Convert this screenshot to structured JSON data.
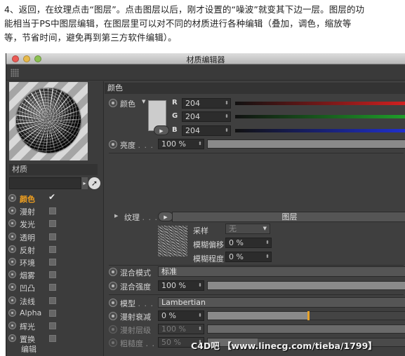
{
  "article": {
    "lines": [
      "4、返回，在纹理点击“图层”。点击图层以后，刚才设置的“噪波”就变其下边一层。图层的功",
      "能相当于PS中图层编辑，在图层里可以对不同的材质进行各种编辑（叠加，调色，缩放等",
      "等，节省时间，避免再到第三方软件编辑）。"
    ]
  },
  "window": {
    "title": "材质编辑器"
  },
  "left": {
    "material_label": "材质",
    "channels": [
      {
        "label": "颜色",
        "checked": true,
        "active": true
      },
      {
        "label": "漫射",
        "checked": false
      },
      {
        "label": "发光",
        "checked": false
      },
      {
        "label": "透明",
        "checked": false
      },
      {
        "label": "反射",
        "checked": false
      },
      {
        "label": "环境",
        "checked": false
      },
      {
        "label": "烟雾",
        "checked": false
      },
      {
        "label": "凹凸",
        "checked": false
      },
      {
        "label": "法线",
        "checked": false
      },
      {
        "label": "Alpha",
        "checked": false
      },
      {
        "label": "辉光",
        "checked": false
      },
      {
        "label": "置换",
        "checked": false
      }
    ],
    "edit_label": "编辑"
  },
  "right": {
    "section_title": "颜色",
    "color": {
      "label": "颜色",
      "swatch": "#cccccc",
      "r_letter": "R",
      "r_value": "204",
      "g_letter": "G",
      "g_value": "204",
      "b_letter": "B",
      "b_value": "204",
      "r_color": "#d22020",
      "g_color": "#1fa02a",
      "b_color": "#2030d0"
    },
    "brightness": {
      "label": "亮度",
      "value": "100 %",
      "level": 1.0
    },
    "texture": {
      "label": "纹理",
      "layer_label": "图层"
    },
    "sampling": {
      "label": "采样",
      "value": "无"
    },
    "blur_offset": {
      "label": "模糊偏移",
      "value": "0 %"
    },
    "blur_amount": {
      "label": "模糊程度",
      "value": "0 %"
    },
    "mix_mode": {
      "label": "混合模式",
      "value": "标准"
    },
    "mix_strength": {
      "label": "混合强度",
      "value": "100 %",
      "level": 1.0
    },
    "model": {
      "label": "模型",
      "value": "Lambertian"
    },
    "diffuse_falloff": {
      "label": "漫射衰减",
      "value": "0 %",
      "level": 0.5
    },
    "diffuse_level": {
      "label": "漫射层级",
      "value": "100 %",
      "level": 1.0
    },
    "roughness": {
      "label": "粗糙度",
      "value": "50 %",
      "level": 0.25
    }
  },
  "watermark": "C4D吧 【www.linecg.com/tieba/1799】"
}
